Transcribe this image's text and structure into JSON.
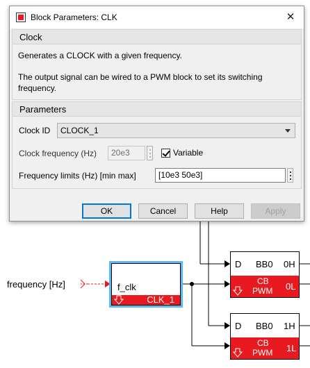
{
  "dialog": {
    "title": "Block Parameters: CLK",
    "close_glyph": "✕",
    "clock_group": {
      "legend": "Clock",
      "description_1": "Generates a CLOCK with a given frequency.",
      "description_2": "The output signal can be wired to a PWM block to set its switching frequency."
    },
    "parameters_group": {
      "legend": "Parameters",
      "clock_id_label": "Clock ID",
      "clock_id_value": "CLOCK_1",
      "clock_freq_label": "Clock frequency (Hz)",
      "clock_freq_value": "20e3",
      "variable_label": "Variable",
      "variable_checked": true,
      "freq_limits_label": "Frequency limits (Hz) [min max]",
      "freq_limits_value": "[10e3 50e3]"
    },
    "buttons": {
      "ok": "OK",
      "cancel": "Cancel",
      "help": "Help",
      "apply": "Apply"
    }
  },
  "canvas": {
    "input_signal_label": "frequency [Hz]",
    "clk_block": {
      "input_port": "f_clk",
      "output_name": "CLK_1"
    },
    "pwm_block_top": {
      "port_d": "D",
      "signal": "BB0",
      "high": "0H",
      "low": "0L",
      "red_line1": "CB",
      "red_line2": "PWM"
    },
    "pwm_block_bottom": {
      "port_d": "D",
      "signal": "BB0",
      "high": "1H",
      "low": "1L",
      "red_line1": "CB",
      "red_line2": "PWM"
    },
    "colors": {
      "block_red": "#e8191f",
      "selection_blue": "#5cb8f0",
      "signal_red": "#e8191f"
    }
  }
}
